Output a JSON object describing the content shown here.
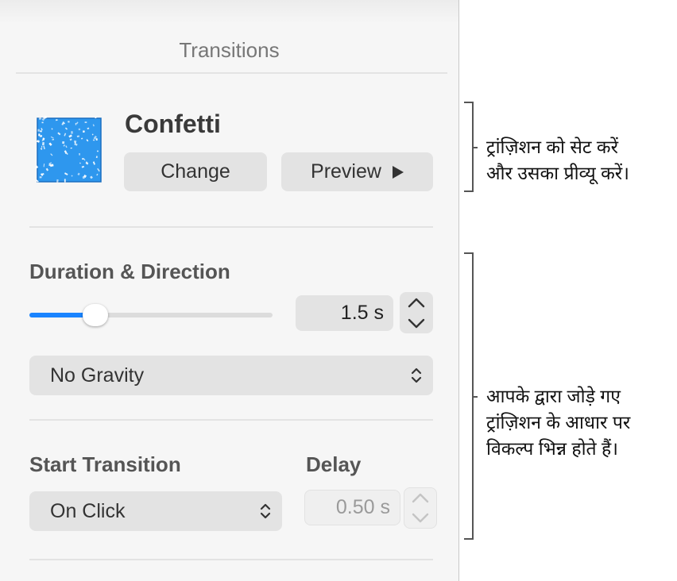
{
  "panel": {
    "title": "Transitions",
    "transition": {
      "name": "Confetti",
      "thumbnail_icon": "confetti-thumbnail",
      "change_label": "Change",
      "preview_label": "Preview",
      "preview_icon": "play-icon"
    },
    "duration_direction": {
      "heading": "Duration & Direction",
      "slider_fraction": 0.27,
      "duration_value": "1.5 s",
      "direction_value": "No Gravity"
    },
    "start": {
      "heading": "Start Transition",
      "value": "On Click",
      "delay_heading": "Delay",
      "delay_value": "0.50 s"
    }
  },
  "callouts": {
    "top": [
      "ट्रांज़िशन को सेट करें",
      "और उसका प्रीव्यू करें।"
    ],
    "bottom": [
      "आपके द्वारा जोड़े गए",
      "ट्रांज़िशन के आधार पर",
      "विकल्प भिन्न होते हैं।"
    ]
  },
  "colors": {
    "accent": "#1a84ff",
    "thumbnail_blue": "#2e97ee"
  }
}
